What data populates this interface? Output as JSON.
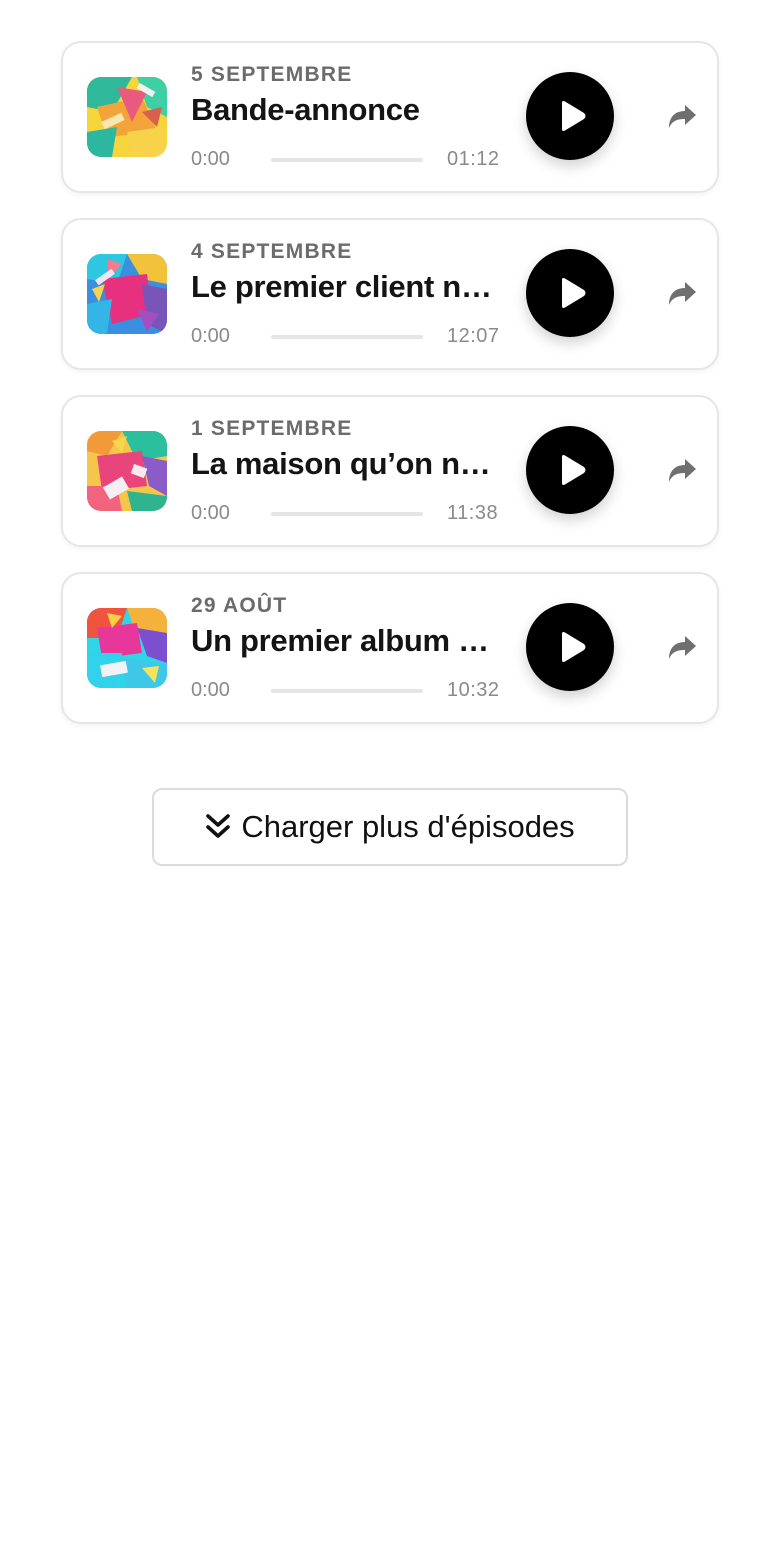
{
  "episodes": [
    {
      "date": "5 SEPTEMBRE",
      "title": "Bande-annonce",
      "current_time": "0:00",
      "duration": "01:12",
      "progress": 0,
      "cover_icon": "abstract-cover-art",
      "play_icon": "play-icon",
      "share_icon": "share-icon"
    },
    {
      "date": "4 SEPTEMBRE",
      "title": "Le premier client n…",
      "current_time": "0:00",
      "duration": "12:07",
      "progress": 0,
      "cover_icon": "abstract-cover-art",
      "play_icon": "play-icon",
      "share_icon": "share-icon"
    },
    {
      "date": "1 SEPTEMBRE",
      "title": "La maison qu’on n…",
      "current_time": "0:00",
      "duration": "11:38",
      "progress": 0,
      "cover_icon": "abstract-cover-art",
      "play_icon": "play-icon",
      "share_icon": "share-icon"
    },
    {
      "date": "29 AOÛT",
      "title": "Un premier album …",
      "current_time": "0:00",
      "duration": "10:32",
      "progress": 0,
      "cover_icon": "abstract-cover-art",
      "play_icon": "play-icon",
      "share_icon": "share-icon"
    }
  ],
  "load_more": {
    "label": "Charger plus d'épisodes",
    "icon": "double-chevron-down-icon"
  },
  "colors": {
    "play_button": "#000000",
    "date_text": "#6b6b6b",
    "title_text": "#141414",
    "time_text": "#8a8a8a",
    "share_icon": "#6f6f6f"
  }
}
